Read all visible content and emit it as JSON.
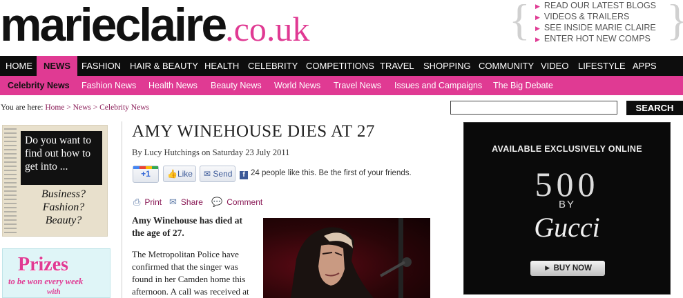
{
  "logo": {
    "name": "marieclaire",
    "domain": ".co.uk"
  },
  "promo_links": [
    "READ OUR LATEST BLOGS",
    "VIDEOS & TRAILERS",
    "SEE INSIDE MARIE CLAIRE",
    "ENTER HOT NEW COMPS"
  ],
  "main_nav": [
    "HOME",
    "NEWS",
    "FASHION",
    "HAIR & BEAUTY",
    "HEALTH",
    "CELEBRITY",
    "COMPETITIONS",
    "TRAVEL",
    "SHOPPING",
    "COMMUNITY",
    "VIDEO",
    "LIFESTYLE",
    "APPS"
  ],
  "main_nav_active": "NEWS",
  "sub_nav": [
    "Celebrity News",
    "Fashion News",
    "Health News",
    "Beauty News",
    "World News",
    "Travel News",
    "Issues and Campaigns",
    "The Big Debate"
  ],
  "sub_nav_active": "Celebrity News",
  "breadcrumb": {
    "prefix": "You are here:",
    "home": "Home",
    "sep": ">",
    "news": "News",
    "current": "Celebrity News"
  },
  "search": {
    "placeholder": "",
    "button": "SEARCH"
  },
  "ad_career": {
    "box_text": "Do you want to find out how to get into ...",
    "lines": [
      "Business?",
      "Fashion?",
      "Beauty?"
    ]
  },
  "ad_prizes": {
    "title": "Prizes",
    "line2": "to be won every week",
    "line3": "with"
  },
  "article": {
    "headline": "AMY WINEHOUSE DIES AT 27",
    "author": "By Lucy Hutchings",
    "date": "on Saturday 23 July 2011",
    "plus_one": "+1",
    "like": "Like",
    "send": "Send",
    "fb_count": "24 people like this. Be the first of your friends.",
    "tools": {
      "print": "Print",
      "share": "Share",
      "comment": "Comment"
    },
    "lede": "Amy Winehouse has died at the age of 27.",
    "body": "The Metropolitan Police have confirmed that the singer was found in her Camden home this afternoon. A call was received at"
  },
  "right_ad": {
    "header": "AVAILABLE EXCLUSIVELY ONLINE",
    "model": "500",
    "by": "BY",
    "brand": "Gucci",
    "cta": "► BUY NOW"
  },
  "colors": {
    "brand_pink": "#e03a93",
    "nav_black": "#0d0d0d",
    "link": "#8a1b57"
  }
}
